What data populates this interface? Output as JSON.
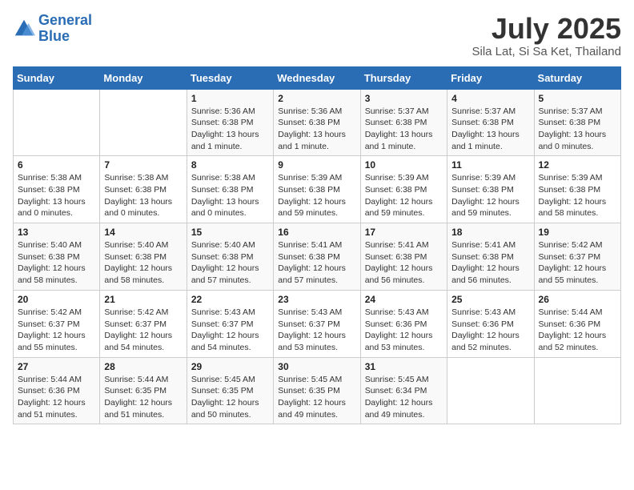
{
  "header": {
    "logo_line1": "General",
    "logo_line2": "Blue",
    "title": "July 2025",
    "subtitle": "Sila Lat, Si Sa Ket, Thailand"
  },
  "days_of_week": [
    "Sunday",
    "Monday",
    "Tuesday",
    "Wednesday",
    "Thursday",
    "Friday",
    "Saturday"
  ],
  "weeks": [
    [
      {
        "day": "",
        "info": ""
      },
      {
        "day": "",
        "info": ""
      },
      {
        "day": "1",
        "info": "Sunrise: 5:36 AM\nSunset: 6:38 PM\nDaylight: 13 hours and 1 minute."
      },
      {
        "day": "2",
        "info": "Sunrise: 5:36 AM\nSunset: 6:38 PM\nDaylight: 13 hours and 1 minute."
      },
      {
        "day": "3",
        "info": "Sunrise: 5:37 AM\nSunset: 6:38 PM\nDaylight: 13 hours and 1 minute."
      },
      {
        "day": "4",
        "info": "Sunrise: 5:37 AM\nSunset: 6:38 PM\nDaylight: 13 hours and 1 minute."
      },
      {
        "day": "5",
        "info": "Sunrise: 5:37 AM\nSunset: 6:38 PM\nDaylight: 13 hours and 0 minutes."
      }
    ],
    [
      {
        "day": "6",
        "info": "Sunrise: 5:38 AM\nSunset: 6:38 PM\nDaylight: 13 hours and 0 minutes."
      },
      {
        "day": "7",
        "info": "Sunrise: 5:38 AM\nSunset: 6:38 PM\nDaylight: 13 hours and 0 minutes."
      },
      {
        "day": "8",
        "info": "Sunrise: 5:38 AM\nSunset: 6:38 PM\nDaylight: 13 hours and 0 minutes."
      },
      {
        "day": "9",
        "info": "Sunrise: 5:39 AM\nSunset: 6:38 PM\nDaylight: 12 hours and 59 minutes."
      },
      {
        "day": "10",
        "info": "Sunrise: 5:39 AM\nSunset: 6:38 PM\nDaylight: 12 hours and 59 minutes."
      },
      {
        "day": "11",
        "info": "Sunrise: 5:39 AM\nSunset: 6:38 PM\nDaylight: 12 hours and 59 minutes."
      },
      {
        "day": "12",
        "info": "Sunrise: 5:39 AM\nSunset: 6:38 PM\nDaylight: 12 hours and 58 minutes."
      }
    ],
    [
      {
        "day": "13",
        "info": "Sunrise: 5:40 AM\nSunset: 6:38 PM\nDaylight: 12 hours and 58 minutes."
      },
      {
        "day": "14",
        "info": "Sunrise: 5:40 AM\nSunset: 6:38 PM\nDaylight: 12 hours and 58 minutes."
      },
      {
        "day": "15",
        "info": "Sunrise: 5:40 AM\nSunset: 6:38 PM\nDaylight: 12 hours and 57 minutes."
      },
      {
        "day": "16",
        "info": "Sunrise: 5:41 AM\nSunset: 6:38 PM\nDaylight: 12 hours and 57 minutes."
      },
      {
        "day": "17",
        "info": "Sunrise: 5:41 AM\nSunset: 6:38 PM\nDaylight: 12 hours and 56 minutes."
      },
      {
        "day": "18",
        "info": "Sunrise: 5:41 AM\nSunset: 6:38 PM\nDaylight: 12 hours and 56 minutes."
      },
      {
        "day": "19",
        "info": "Sunrise: 5:42 AM\nSunset: 6:37 PM\nDaylight: 12 hours and 55 minutes."
      }
    ],
    [
      {
        "day": "20",
        "info": "Sunrise: 5:42 AM\nSunset: 6:37 PM\nDaylight: 12 hours and 55 minutes."
      },
      {
        "day": "21",
        "info": "Sunrise: 5:42 AM\nSunset: 6:37 PM\nDaylight: 12 hours and 54 minutes."
      },
      {
        "day": "22",
        "info": "Sunrise: 5:43 AM\nSunset: 6:37 PM\nDaylight: 12 hours and 54 minutes."
      },
      {
        "day": "23",
        "info": "Sunrise: 5:43 AM\nSunset: 6:37 PM\nDaylight: 12 hours and 53 minutes."
      },
      {
        "day": "24",
        "info": "Sunrise: 5:43 AM\nSunset: 6:36 PM\nDaylight: 12 hours and 53 minutes."
      },
      {
        "day": "25",
        "info": "Sunrise: 5:43 AM\nSunset: 6:36 PM\nDaylight: 12 hours and 52 minutes."
      },
      {
        "day": "26",
        "info": "Sunrise: 5:44 AM\nSunset: 6:36 PM\nDaylight: 12 hours and 52 minutes."
      }
    ],
    [
      {
        "day": "27",
        "info": "Sunrise: 5:44 AM\nSunset: 6:36 PM\nDaylight: 12 hours and 51 minutes."
      },
      {
        "day": "28",
        "info": "Sunrise: 5:44 AM\nSunset: 6:35 PM\nDaylight: 12 hours and 51 minutes."
      },
      {
        "day": "29",
        "info": "Sunrise: 5:45 AM\nSunset: 6:35 PM\nDaylight: 12 hours and 50 minutes."
      },
      {
        "day": "30",
        "info": "Sunrise: 5:45 AM\nSunset: 6:35 PM\nDaylight: 12 hours and 49 minutes."
      },
      {
        "day": "31",
        "info": "Sunrise: 5:45 AM\nSunset: 6:34 PM\nDaylight: 12 hours and 49 minutes."
      },
      {
        "day": "",
        "info": ""
      },
      {
        "day": "",
        "info": ""
      }
    ]
  ]
}
